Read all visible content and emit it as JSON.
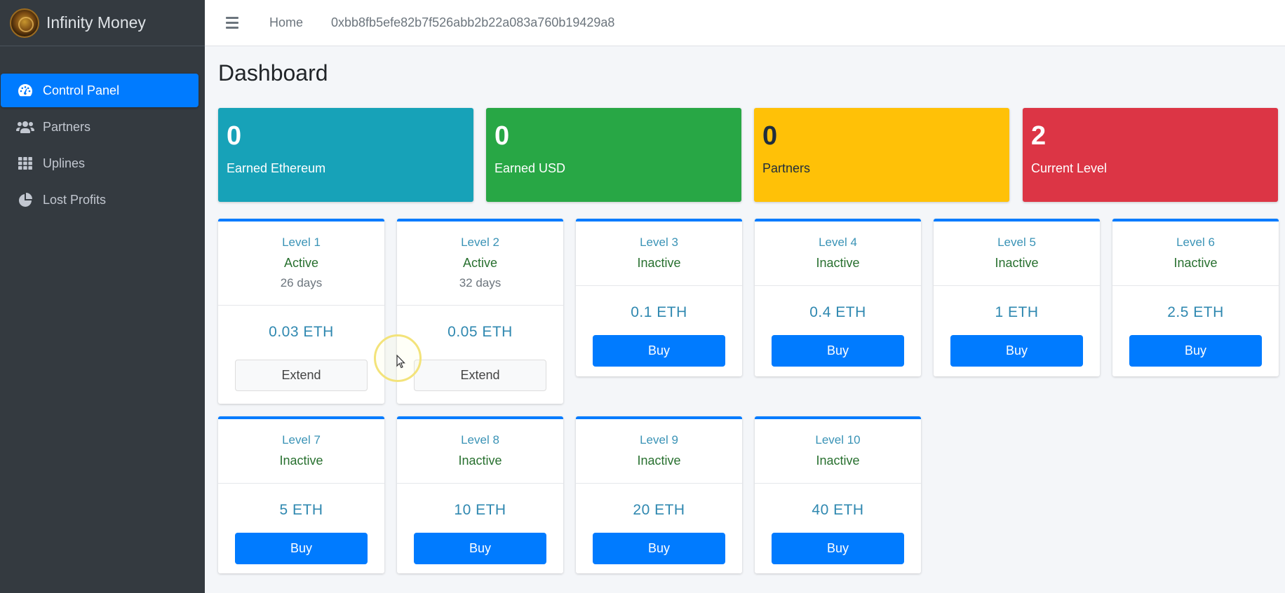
{
  "brand": {
    "name": "Infinity Money"
  },
  "sidebar": {
    "items": [
      {
        "label": "Control Panel",
        "icon": "speedometer-icon",
        "active": true
      },
      {
        "label": "Partners",
        "icon": "users-icon",
        "active": false
      },
      {
        "label": "Uplines",
        "icon": "grid-icon",
        "active": false
      },
      {
        "label": "Lost Profits",
        "icon": "pie-chart-icon",
        "active": false
      }
    ]
  },
  "topbar": {
    "home_label": "Home",
    "address": "0xbb8fb5efe82b7f526abb2b22a083a760b19429a8"
  },
  "main": {
    "title": "Dashboard",
    "stats": [
      {
        "value": "0",
        "label": "Earned Ethereum",
        "color": "#17a2b8"
      },
      {
        "value": "0",
        "label": "Earned USD",
        "color": "#28a745"
      },
      {
        "value": "0",
        "label": "Partners",
        "color": "#ffc107"
      },
      {
        "value": "2",
        "label": "Current Level",
        "color": "#dc3545"
      }
    ],
    "levels": [
      {
        "title": "Level 1",
        "status": "Active",
        "days": "26 days",
        "price": "0.03 ETH",
        "action": "Extend"
      },
      {
        "title": "Level 2",
        "status": "Active",
        "days": "32 days",
        "price": "0.05 ETH",
        "action": "Extend"
      },
      {
        "title": "Level 3",
        "status": "Inactive",
        "price": "0.1 ETH",
        "action": "Buy"
      },
      {
        "title": "Level 4",
        "status": "Inactive",
        "price": "0.4 ETH",
        "action": "Buy"
      },
      {
        "title": "Level 5",
        "status": "Inactive",
        "price": "1 ETH",
        "action": "Buy"
      },
      {
        "title": "Level 6",
        "status": "Inactive",
        "price": "2.5 ETH",
        "action": "Buy"
      },
      {
        "title": "Level 7",
        "status": "Inactive",
        "price": "5 ETH",
        "action": "Buy"
      },
      {
        "title": "Level 8",
        "status": "Inactive",
        "price": "10 ETH",
        "action": "Buy"
      },
      {
        "title": "Level 9",
        "status": "Inactive",
        "price": "20 ETH",
        "action": "Buy"
      },
      {
        "title": "Level 10",
        "status": "Inactive",
        "price": "40 ETH",
        "action": "Buy"
      }
    ]
  }
}
